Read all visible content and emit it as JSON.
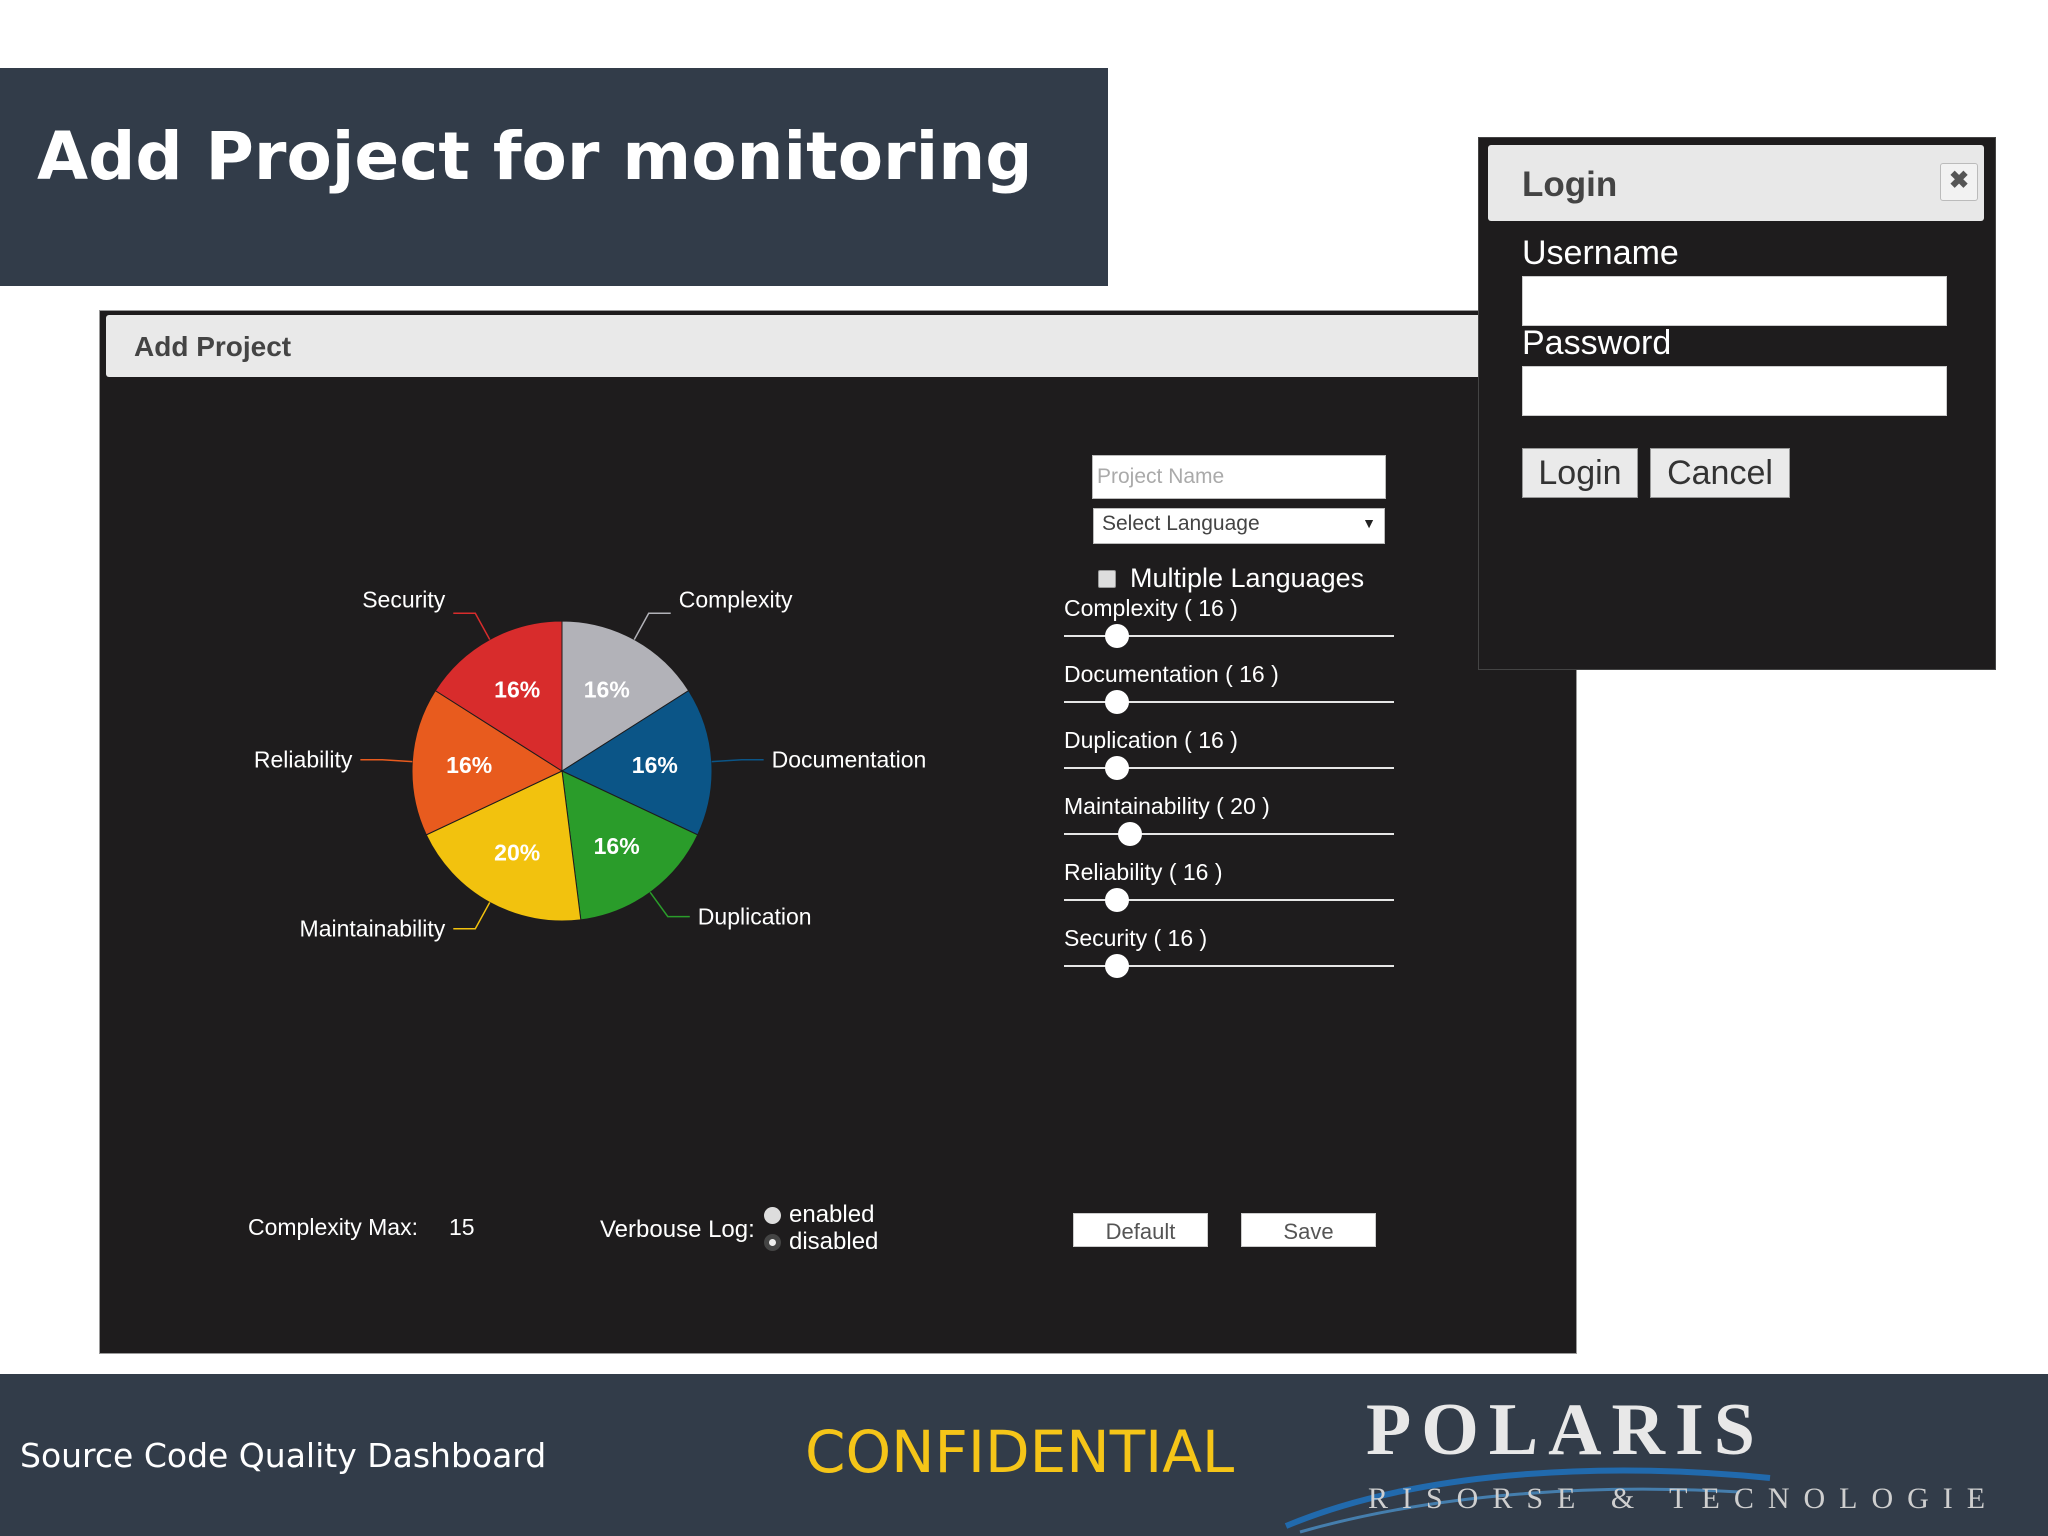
{
  "slide": {
    "title": "Add Project for monitoring"
  },
  "add_project": {
    "title": "Add Project",
    "project_name_placeholder": "Project Name",
    "language_select": "Select Language",
    "multiple_languages_label": "Multiple Languages",
    "sliders": [
      {
        "label": "Complexity ( 16 )",
        "value": 16
      },
      {
        "label": "Documentation ( 16 )",
        "value": 16
      },
      {
        "label": "Duplication ( 16 )",
        "value": 16
      },
      {
        "label": "Maintainability ( 20 )",
        "value": 20
      },
      {
        "label": "Reliability ( 16 )",
        "value": 16
      },
      {
        "label": "Security ( 16 )",
        "value": 16
      }
    ],
    "slider_max": 100,
    "complexity_max_label": "Complexity Max:",
    "complexity_max_value": "15",
    "verbose_log_label": "Verbouse Log:",
    "verbose_options": [
      "enabled",
      "disabled"
    ],
    "verbose_selected": "disabled",
    "default_button": "Default",
    "save_button": "Save"
  },
  "chart_data": {
    "type": "pie",
    "categories": [
      "Complexity",
      "Documentation",
      "Duplication",
      "Maintainability",
      "Reliability",
      "Security"
    ],
    "values": [
      16,
      16,
      16,
      20,
      16,
      16
    ],
    "data_labels": [
      "16%",
      "16%",
      "16%",
      "20%",
      "16%",
      "16%"
    ],
    "colors": [
      "#b2b2b8",
      "#0b5587",
      "#2a9c2a",
      "#f2c20e",
      "#e85b1e",
      "#d82c2c"
    ],
    "label_colors": [
      "#ffffff",
      "#ffffff",
      "#ffffff",
      "#ffffff",
      "#ffffff",
      "#ffffff"
    ],
    "legend": "none"
  },
  "login": {
    "title": "Login",
    "close_icon": "close-icon",
    "username_label": "Username",
    "password_label": "Password",
    "login_button": "Login",
    "cancel_button": "Cancel"
  },
  "footer": {
    "left_text": "Source Code Quality Dashboard",
    "center_text": "CONFIDENTIAL",
    "logo_text": "POLARIS",
    "logo_subtext": "RISORSE & TECNOLOGIE"
  }
}
